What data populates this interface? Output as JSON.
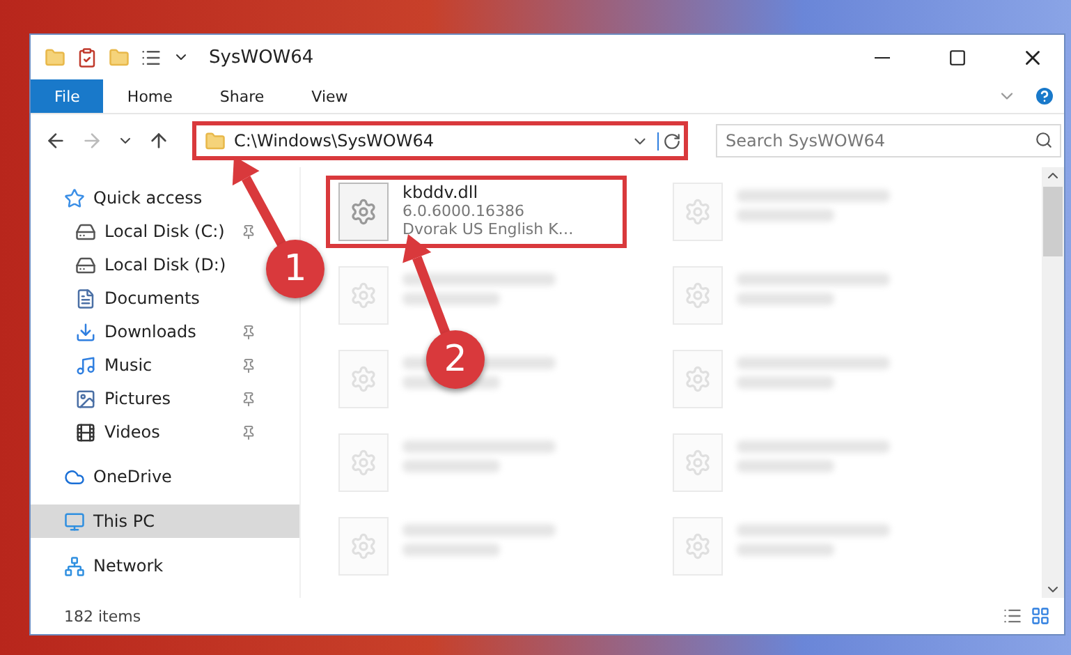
{
  "window": {
    "title": "SysWOW64"
  },
  "ribbon_tabs": [
    {
      "label": "File",
      "selected": true
    },
    {
      "label": "Home",
      "selected": false
    },
    {
      "label": "Share",
      "selected": false
    },
    {
      "label": "View",
      "selected": false
    }
  ],
  "address": {
    "path": "C:\\Windows\\SysWOW64",
    "highlighted": true
  },
  "search": {
    "placeholder": "Search SysWOW64"
  },
  "sidebar": {
    "items": [
      {
        "label": "Quick access",
        "kind": "star",
        "selected": false,
        "children": [
          {
            "label": "Local Disk (C:)",
            "kind": "drive",
            "pinned": true,
            "selected": false
          },
          {
            "label": "Local Disk (D:)",
            "kind": "drive",
            "pinned": false,
            "selected": false
          },
          {
            "label": "Documents",
            "kind": "documents",
            "pinned": false,
            "selected": false
          },
          {
            "label": "Downloads",
            "kind": "downloads",
            "pinned": true,
            "selected": false
          },
          {
            "label": "Music",
            "kind": "music",
            "pinned": true,
            "selected": false
          },
          {
            "label": "Pictures",
            "kind": "pictures",
            "pinned": true,
            "selected": false
          },
          {
            "label": "Videos",
            "kind": "videos",
            "pinned": true,
            "selected": false
          }
        ]
      },
      {
        "label": "OneDrive",
        "kind": "cloud",
        "selected": false
      },
      {
        "label": "This PC",
        "kind": "pc",
        "selected": true
      },
      {
        "label": "Network",
        "kind": "network",
        "selected": false
      }
    ]
  },
  "files": [
    {
      "name": "kbddv.dll",
      "details": [
        "6.0.6000.16386",
        "Dvorak US English K…"
      ],
      "highlighted": true,
      "blurred": false
    },
    {
      "highlighted": false,
      "blurred": true
    },
    {
      "highlighted": false,
      "blurred": true
    },
    {
      "highlighted": false,
      "blurred": true
    },
    {
      "highlighted": false,
      "blurred": true
    },
    {
      "highlighted": false,
      "blurred": true
    },
    {
      "highlighted": false,
      "blurred": true
    },
    {
      "highlighted": false,
      "blurred": true
    },
    {
      "highlighted": false,
      "blurred": true
    },
    {
      "highlighted": false,
      "blurred": true
    }
  ],
  "status_bar": {
    "item_count": "182 items"
  },
  "callouts": [
    {
      "label": "1"
    },
    {
      "label": "2"
    }
  ]
}
